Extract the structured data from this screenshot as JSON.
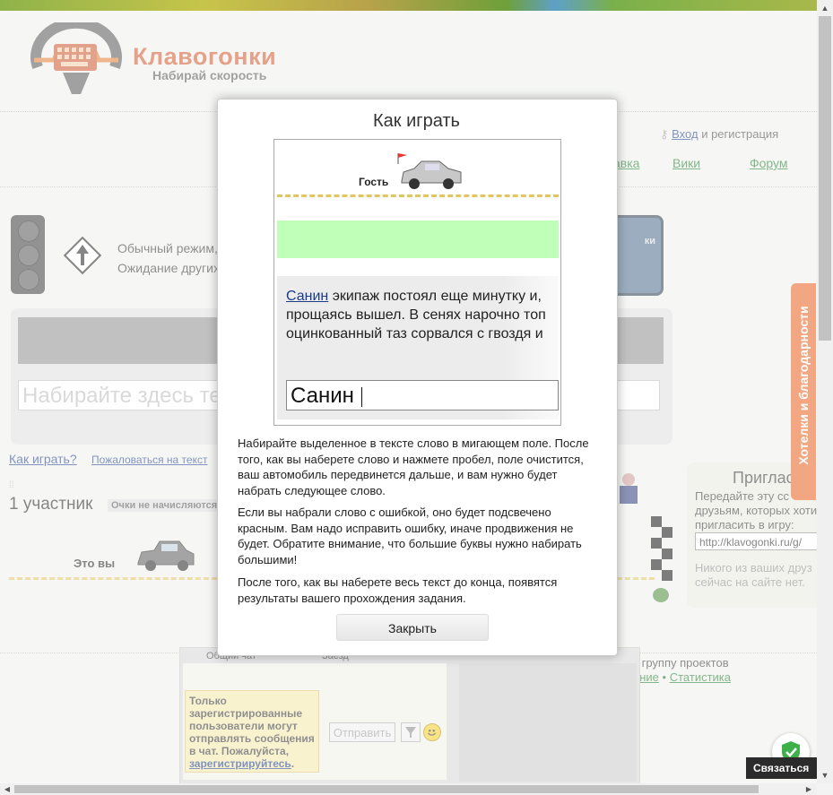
{
  "header": {
    "logo_title": "Клавогонки",
    "logo_subtitle": "Набирай скорость",
    "login_link": "Вход",
    "login_suffix": "и регистрация",
    "nav": {
      "a_partial": "авка",
      "wiki": "Вики",
      "forum": "Форум"
    }
  },
  "game": {
    "mode_line1": "Обычный режим,",
    "mode_line2": "Ожидание других",
    "input_placeholder": "Набирайте здесь те",
    "screen_label": "ки",
    "how_to_play_link": "Как играть?",
    "complain_link": "Пожаловаться на текст",
    "participants": "1 участник",
    "points_badge": "Очки не начисляются",
    "you_label": "Это вы"
  },
  "invite": {
    "title": "Приглас",
    "text": "Передайте эту сс друзьям, которых хоти пригласить в игру:",
    "url": "http://klavogonki.ru/g/",
    "friends_note": "Никого из ваших друз сейчас на сайте нет."
  },
  "side_tab": {
    "label": "Хотелки и благодарности"
  },
  "footer": {
    "group_text": "з группу проектов",
    "link_partial": "ение",
    "separator": "•",
    "stats_link": "Статистика"
  },
  "chat": {
    "tab_general": "Общий чат",
    "tab_race": "Заезд",
    "notice_text": "Только зарегистрированные пользователи могут отправлять сообщения в чат. Пожалуйста,",
    "notice_link": "зарегистрируйтесь",
    "notice_end": ".",
    "send_label": "Отправить"
  },
  "dialog": {
    "title": "Как играть",
    "demo": {
      "guest_label": "Гость",
      "highlighted_word": "Санин",
      "text_line1_rest": " экипаж постоял еще минутку и,",
      "text_line2": "прощаясь вышел. В сенях нарочно топ",
      "text_line3": "оцинкованный таз сорвался с гвоздя и",
      "input_value": "Санин"
    },
    "para1": "Набирайте выделенное в тексте слово в мигающем поле. После того, как вы наберете слово и нажмете пробел, поле очистится, ваш автомобиль передвинется дальше, и вам нужно будет набрать следующее слово.",
    "para2": "Если вы набрали слово с ошибкой, оно будет подсвечено красным. Вам надо исправить ошибку, иначе продвижения не будет. Обратите внимание, что большие буквы нужно набирать большими!",
    "para3": "После того, как вы наберете весь текст до конца, появятся результаты вашего прохождения задания.",
    "close_label": "Закрыть"
  },
  "widgets": {
    "contact_label": "Связаться"
  },
  "icons": {
    "key": "key-icon",
    "arrow_sign": "arrow-up-sign-icon",
    "car": "car-icon",
    "finish": "finish-flag-icon",
    "filter": "filter-icon",
    "smile": "smile-icon",
    "shield": "shield-check-icon"
  },
  "colors": {
    "brand_orange": "#d2552a",
    "side_tab": "#e8601c",
    "highlight_green": "#bfffb8",
    "track_yellow": "#e2c460"
  }
}
